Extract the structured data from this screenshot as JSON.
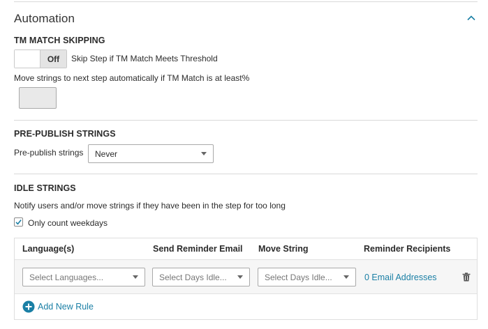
{
  "section": {
    "title": "Automation"
  },
  "tm_skipping": {
    "heading": "TM MATCH SKIPPING",
    "toggle_label": "Off",
    "toggle_description": "Skip Step if TM Match Meets Threshold",
    "threshold_label": "Move strings to next step automatically if TM Match is at least%",
    "threshold_value": ""
  },
  "pre_publish": {
    "heading": "PRE-PUBLISH STRINGS",
    "label": "Pre-publish strings",
    "selected": "Never"
  },
  "idle_strings": {
    "heading": "IDLE STRINGS",
    "description": "Notify users and/or move strings if they have been in the step for too long",
    "weekdays_label": "Only count weekdays",
    "weekdays_checked": true
  },
  "rules_table": {
    "columns": [
      "Language(s)",
      "Send Reminder Email",
      "Move String",
      "Reminder Recipients"
    ],
    "row": {
      "languages_placeholder": "Select Languages...",
      "reminder_placeholder": "Select Days Idle...",
      "move_placeholder": "Select Days Idle...",
      "recipients_link": "0 Email Addresses"
    },
    "add_rule_label": "Add New Rule"
  },
  "colors": {
    "accent": "#1a7fa5",
    "divider": "#d9d9d9",
    "row_bg": "#f6f6f6"
  },
  "icons": {
    "collapse": "chevron-up-icon",
    "checkbox": "checkmark-icon",
    "delete": "trash-icon",
    "add": "plus-circle-icon",
    "caret": "caret-down-icon"
  }
}
